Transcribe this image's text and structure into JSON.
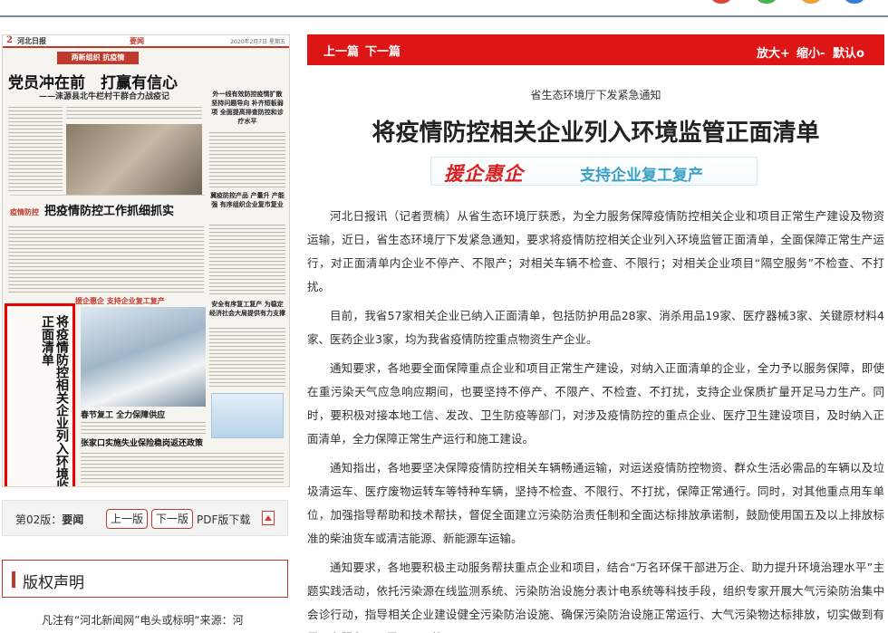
{
  "toolbar": {
    "prev_label": "上一篇",
    "next_label": "下一篇",
    "zoom_in_label": "放大+",
    "zoom_out_label": "缩小-",
    "reset_label": "默认o"
  },
  "article": {
    "kicker": "省生态环境厅下发紧急通知",
    "headline": "将疫情防控相关企业列入环境监管正面清单",
    "tag_left": "援企惠企",
    "tag_right": "支持企业复工复产",
    "paragraphs": [
      "河北日报讯（记者贾楠）从省生态环境厅获悉，为全力服务保障疫情防控相关企业和项目正常生产建设及物资运输，近日，省生态环境厅下发紧急通知，要求将疫情防控相关企业列入环境监管正面清单，全面保障正常生产运行，对正面清单内企业不停产、不限产；对相关车辆不检查、不限行；对相关企业项目“隔空服务”不检查、不打扰。",
      "目前，我省57家相关企业已纳入正面清单，包括防护用品28家、消杀用品19家、医疗器械3家、关键原材料4家、医药企业3家，均为我省疫情防控重点物资生产企业。",
      "通知要求，各地要全面保障重点企业和项目正常生产建设，对纳入正面清单的企业，全力予以服务保障，即使在重污染天气应急响应期间，也要坚持不停产、不限产、不检查、不打扰，支持企业保质扩量开足马力生产。同时，要积极对接本地工信、发改、卫生防疫等部门，对涉及疫情防控的重点企业、医疗卫生建设项目，及时纳入正面清单，全力保障正常生产运行和施工建设。",
      "通知指出，各地要坚决保障疫情防控相关车辆畅通运输，对运送疫情防控物资、群众生活必需品的车辆以及垃圾清运车、医疗废物运转车等特种车辆，坚持不检查、不限行、不打扰，保障正常通行。同时，对其他重点用车单位，加强指导帮助和技术帮扶，督促全面建立污染防治责任制和全面达标排放承诺制，鼓励使用国五及以上排放标准的柴油货车或清洁能源、新能源车运输。",
      "通知要求，各地要积极主动服务帮扶重点企业和项目，结合“万名环保干部进万企、助力提升环境治理水平”主题实践活动，依托污染源在线监测系统、污染防治设施分表计电系统等科技手段，组织专家开展大气污染防治集中会诊行动，指导相关企业建设健全污染防治设施、确保污染防治设施正常运行、大气污染物达标排放，切实做到有需要有服务，无需要不干扰。"
    ]
  },
  "newspaper": {
    "page_number": "2",
    "masthead": "河北日报",
    "section": "要闻",
    "date": "2020年2月7日 星期五",
    "banner": "两新组织 抗疫情",
    "headline": "党员冲在前　打赢有信心",
    "subheadline": "——涞源县北牛栏村干群合力战疫记",
    "section_head_tag": "疫情防控",
    "section_head": "把疫情防控工作抓细抓实",
    "side_head_1": "外一线有效防控疫情扩散 坚持问题导向 补齐短板弱项 全面提高排查防控和诊疗水平",
    "side_head_2": "冀疫防控产品 产量升 产能强 有序组织企业复市复业",
    "side_head_3": "安全有序复工复产 为稳定经济社会大局提供有力支撑",
    "help_tag": "援企惠企 支持企业复工复产",
    "vertical_title": "将疫情防控相关企业列入环境监管正面清单",
    "photo_caption": "春节复工 全力保障供应",
    "bottom_title": "张家口实施失业保险稳岗返还政策"
  },
  "pager": {
    "label_prefix": "第02版：",
    "label_section": "要闻",
    "prev_label": "上一版",
    "next_label": "下一版",
    "pdf_label": "PDF版下载"
  },
  "copyright": {
    "title": "版权声明",
    "text": "凡注有“河北新闻网”电头或标明“来源：河"
  }
}
